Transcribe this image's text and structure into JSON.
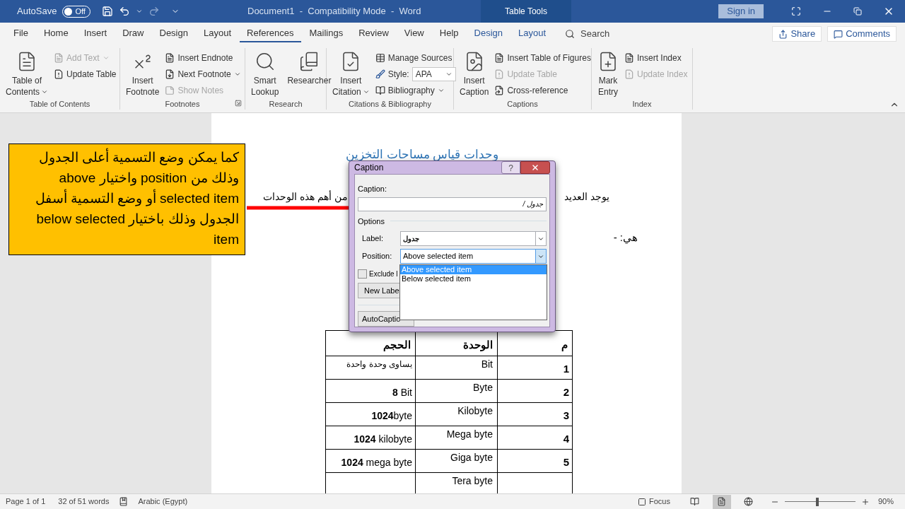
{
  "title_bar": {
    "autosave": "AutoSave",
    "autosave_toggle": {
      "label": "Off",
      "on": false
    },
    "title": "Document1  -  Compatibility Mode  -  Word",
    "context_tab": "Table Tools",
    "sign_in": "Sign in"
  },
  "tabs": [
    {
      "label": "File",
      "selected": false,
      "kind": "normal"
    },
    {
      "label": "Home",
      "selected": false,
      "kind": "normal"
    },
    {
      "label": "Insert",
      "selected": false,
      "kind": "normal"
    },
    {
      "label": "Draw",
      "selected": false,
      "kind": "normal"
    },
    {
      "label": "Design",
      "selected": false,
      "kind": "normal"
    },
    {
      "label": "Layout",
      "selected": false,
      "kind": "normal"
    },
    {
      "label": "References",
      "selected": true,
      "kind": "normal"
    },
    {
      "label": "Mailings",
      "selected": false,
      "kind": "normal"
    },
    {
      "label": "Review",
      "selected": false,
      "kind": "normal"
    },
    {
      "label": "View",
      "selected": false,
      "kind": "normal"
    },
    {
      "label": "Help",
      "selected": false,
      "kind": "normal"
    },
    {
      "label": "Design",
      "selected": false,
      "kind": "contextual"
    },
    {
      "label": "Layout",
      "selected": false,
      "kind": "contextual"
    }
  ],
  "search": {
    "placeholder": "Search"
  },
  "share": "Share",
  "comments": "Comments",
  "ribbon": [
    {
      "name": "Table of Contents",
      "launcher": false,
      "items": [
        {
          "kind": "large",
          "lines": [
            "Table of",
            "Contents"
          ],
          "dropdown": true,
          "disabled": false
        },
        {
          "kind": "stack",
          "items": [
            {
              "kind": "small",
              "label": "Add Text",
              "dropdown": true,
              "disabled": true
            },
            {
              "kind": "small",
              "label": "Update Table",
              "dropdown": false,
              "disabled": false
            }
          ]
        }
      ]
    },
    {
      "name": "Footnotes",
      "launcher": true,
      "items": [
        {
          "kind": "large",
          "lines": [
            "Insert",
            "Footnote"
          ],
          "dropdown": false,
          "disabled": false
        },
        {
          "kind": "stack",
          "items": [
            {
              "kind": "small",
              "label": "Insert Endnote",
              "dropdown": false,
              "disabled": false
            },
            {
              "kind": "small",
              "label": "Next Footnote",
              "dropdown": true,
              "disabled": false
            },
            {
              "kind": "small",
              "label": "Show Notes",
              "dropdown": false,
              "disabled": true
            }
          ]
        }
      ]
    },
    {
      "name": "Research",
      "launcher": false,
      "items": [
        {
          "kind": "large",
          "lines": [
            "Smart",
            "Lookup"
          ],
          "dropdown": false,
          "disabled": false
        },
        {
          "kind": "large",
          "lines": [
            "Researcher"
          ],
          "dropdown": false,
          "disabled": false
        }
      ]
    },
    {
      "name": "Citations & Bibliography",
      "launcher": false,
      "items": [
        {
          "kind": "large",
          "lines": [
            "Insert",
            "Citation"
          ],
          "dropdown": true,
          "disabled": false
        },
        {
          "kind": "stack",
          "items": [
            {
              "kind": "small",
              "label": "Manage Sources",
              "dropdown": false,
              "disabled": false
            },
            {
              "kind": "combo",
              "label": "Style:",
              "value": "APA"
            },
            {
              "kind": "small",
              "label": "Bibliography",
              "dropdown": true,
              "disabled": false
            }
          ]
        }
      ]
    },
    {
      "name": "Captions",
      "launcher": false,
      "items": [
        {
          "kind": "large",
          "lines": [
            "Insert",
            "Caption"
          ],
          "dropdown": false,
          "disabled": false
        },
        {
          "kind": "stack",
          "items": [
            {
              "kind": "small",
              "label": "Insert Table of Figures",
              "dropdown": false,
              "disabled": false
            },
            {
              "kind": "small",
              "label": "Update Table",
              "dropdown": false,
              "disabled": true
            },
            {
              "kind": "small",
              "label": "Cross-reference",
              "dropdown": false,
              "disabled": false
            }
          ]
        }
      ]
    },
    {
      "name": "Index",
      "launcher": false,
      "items": [
        {
          "kind": "large",
          "lines": [
            "Mark",
            "Entry"
          ],
          "dropdown": false,
          "disabled": false
        },
        {
          "kind": "stack",
          "items": [
            {
              "kind": "small",
              "label": "Insert Index",
              "dropdown": false,
              "disabled": false
            },
            {
              "kind": "small",
              "label": "Update Index",
              "dropdown": false,
              "disabled": true
            }
          ]
        }
      ]
    }
  ],
  "document": {
    "heading": "وحدات قياس مساحات التخزين",
    "line_right": "يوجد العديد",
    "line_left": "من أهم هذه الوحدات",
    "line2": "هي: -",
    "table": {
      "columns": [
        "م",
        "الوحدة",
        "الحجم"
      ],
      "rows": [
        {
          "index": "1",
          "unit": "Bit",
          "size": "يساوى وحدة واحدة"
        },
        {
          "index": "2",
          "unit": "Byte",
          "size": "**8** Bit"
        },
        {
          "index": "3",
          "unit": "Kilobyte",
          "size": "**1024**byte"
        },
        {
          "index": "4",
          "unit": "Mega byte",
          "size": "**1024** kilobyte"
        },
        {
          "index": "5",
          "unit": "Giga byte",
          "size": "**1024** mega byte"
        },
        {
          "unit": "Tera byte"
        }
      ]
    }
  },
  "callout": {
    "text": "كما يمكن وضع التسمية أعلى الجدول وذلك من position واختيار above selected item أو وضع التسمية أسفل الجدول وذلك باختيار below selected item"
  },
  "dialog": {
    "title": "Caption",
    "help": "?",
    "caption_label": "Caption:",
    "caption_value": "جدول /",
    "options_label": "Options",
    "label_label": "Label:",
    "label_value": "جدول",
    "position_label": "Position:",
    "position_value": "Above selected item",
    "position_options": [
      {
        "label": "Above selected item",
        "selected": true
      },
      {
        "label": "Below selected item",
        "selected": false
      }
    ],
    "exclude": {
      "label": "Exclude l",
      "checked": false
    },
    "new_label_button": "New Labe",
    "autocaption_button": "AutoCaptio"
  },
  "status_bar": {
    "page": "Page 1 of 1",
    "words": "32 of 51 words",
    "language": "Arabic (Egypt)",
    "focus": "Focus",
    "views": [
      {
        "selected": false
      },
      {
        "selected": true
      },
      {
        "selected": false
      }
    ],
    "zoom": {
      "level": 0.46,
      "reading": "90%"
    }
  }
}
